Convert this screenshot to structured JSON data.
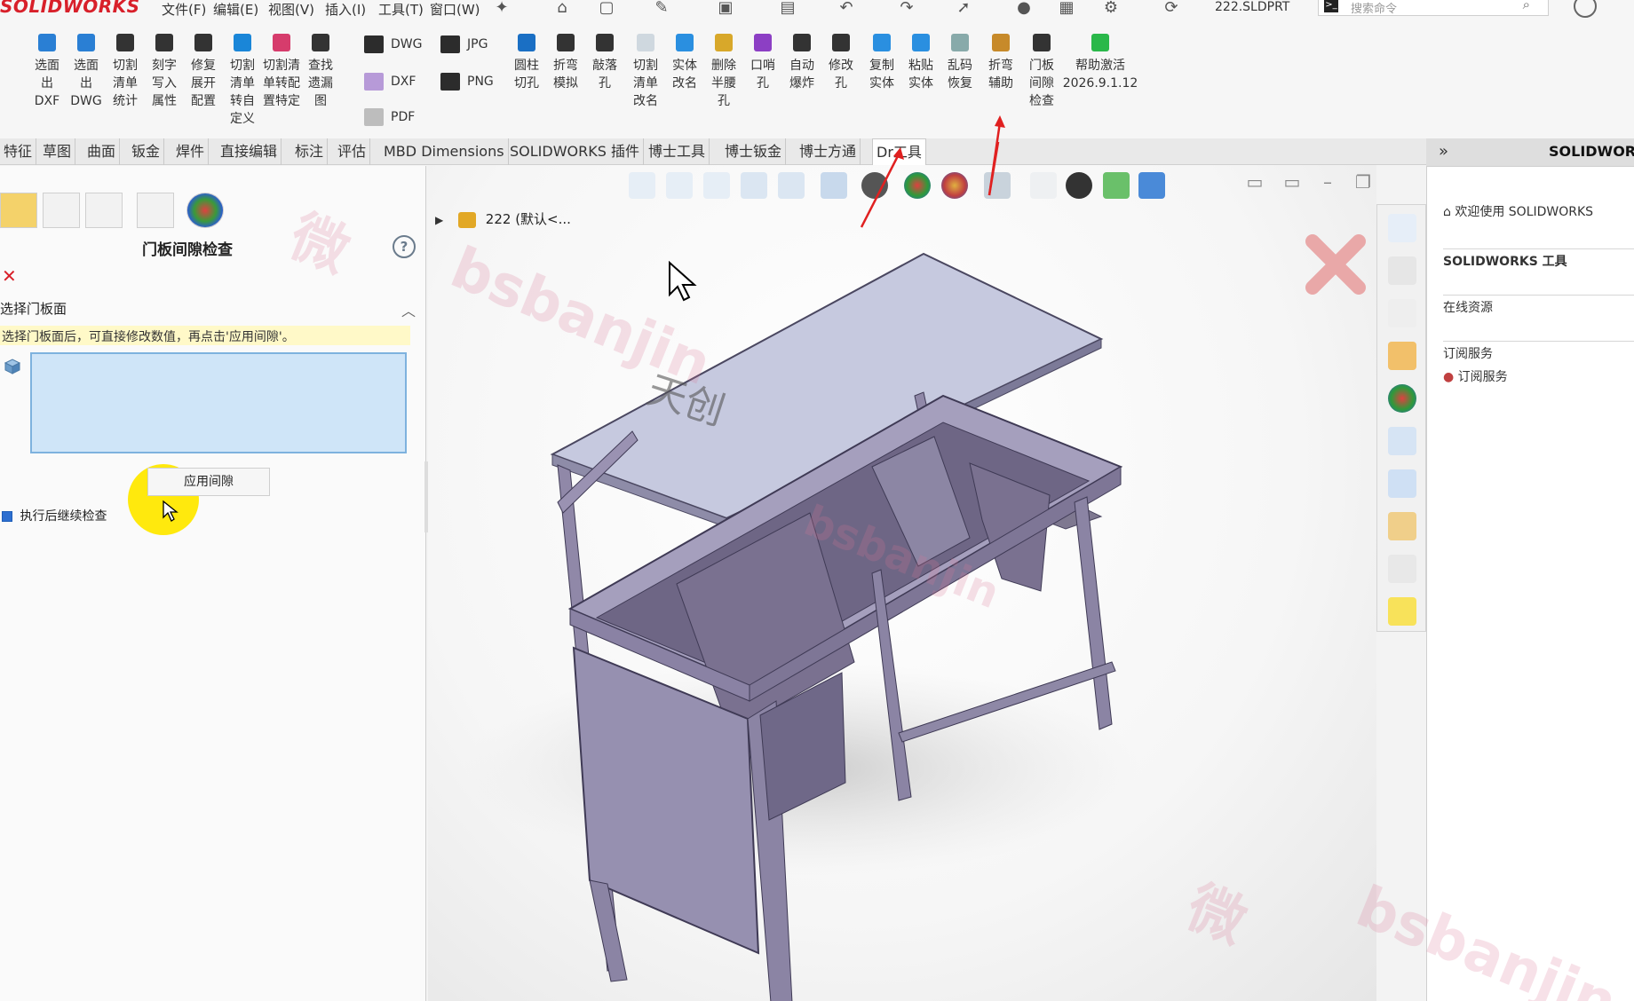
{
  "app": {
    "logo": "SOLIDWORKS",
    "filename": "222.SLDPRT",
    "search_placeholder": "搜索命令"
  },
  "menu": [
    "文件(F)",
    "编辑(E)",
    "视图(V)",
    "插入(I)",
    "工具(T)",
    "窗口(W)"
  ],
  "ribbon": {
    "buttons": [
      {
        "label": "选面\n出\nDXF",
        "icon": "export-dxf-icon",
        "color": "#2a7fd4"
      },
      {
        "label": "选面\n出\nDWG",
        "icon": "export-dwg-icon",
        "color": "#2a7fd4"
      },
      {
        "label": "切割\n清单\n统计",
        "icon": "cutlist-stats-icon",
        "color": "#333333"
      },
      {
        "label": "刻字\n写入\n属性",
        "icon": "engrave-icon",
        "color": "#333333"
      },
      {
        "label": "修复\n展开\n配置",
        "icon": "repair-icon",
        "color": "#333333"
      },
      {
        "label": "切割\n清单\n转自\n定义",
        "icon": "cutlist-custom-icon",
        "color": "#1a86d8"
      },
      {
        "label": "切割清\n单转配\n置特定",
        "icon": "cutlist-config-icon",
        "color": "#d63c6c"
      },
      {
        "label": "查找\n遗漏\n图",
        "icon": "find-icon",
        "color": "#333333"
      }
    ],
    "export_buttons": [
      {
        "label": "DWG",
        "icon": "dwg-icon"
      },
      {
        "label": "JPG",
        "icon": "jpg-icon"
      },
      {
        "label": "DXF",
        "icon": "dxf-icon"
      },
      {
        "label": "PNG",
        "icon": "png-icon"
      },
      {
        "label": "PDF",
        "icon": "pdf-icon"
      }
    ],
    "buttons2": [
      {
        "label": "圆柱\n切孔",
        "icon": "cylinder-cut-icon",
        "color": "#1a6fc4"
      },
      {
        "label": "折弯\n模拟",
        "icon": "bend-sim-icon",
        "color": "#333333"
      },
      {
        "label": "敲落\n孔",
        "icon": "knockout-icon",
        "color": "#333333"
      },
      {
        "label": "切割\n清单\n改名",
        "icon": "cutlist-rename-icon",
        "color": "#cfd8df"
      },
      {
        "label": "实体\n改名",
        "icon": "body-rename-icon",
        "color": "#2a8fe0"
      },
      {
        "label": "删除\n半腰\n孔",
        "icon": "delete-hole-icon",
        "color": "#d8a82a"
      },
      {
        "label": "口哨\n孔",
        "icon": "whistle-hole-icon",
        "color": "#8c3fc4"
      },
      {
        "label": "自动\n爆炸",
        "icon": "auto-explode-icon",
        "color": "#333333"
      },
      {
        "label": "修改\n孔",
        "icon": "modify-hole-icon",
        "color": "#333333"
      },
      {
        "label": "复制\n实体",
        "icon": "copy-body-icon",
        "color": "#2a8fe0"
      },
      {
        "label": "粘贴\n实体",
        "icon": "paste-body-icon",
        "color": "#2a8fe0"
      },
      {
        "label": "乱码\n恢复",
        "icon": "garble-restore-icon",
        "color": "#8aa"
      },
      {
        "label": "折弯\n辅助",
        "icon": "bend-assist-icon",
        "color": "#c78a2a"
      },
      {
        "label": "门板\n间隙\n检查",
        "icon": "door-gap-check-icon",
        "color": "#333333"
      },
      {
        "label": "帮助激活\n2026.9.1.12",
        "icon": "help-activate-icon",
        "color": "#2ab84a"
      }
    ]
  },
  "tabs": [
    "特征",
    "草图",
    "曲面",
    "钣金",
    "焊件",
    "直接编辑",
    "标注",
    "评估",
    "MBD Dimensions",
    "SOLIDWORKS 插件",
    "博士工具",
    "博士钣金",
    "博士方通",
    "Dr工具"
  ],
  "active_tab": "Dr工具",
  "property_manager": {
    "title": "门板间隙检查",
    "help": "?",
    "cancel": "✕",
    "section_title": "选择门板面",
    "hint": "选择门板面后，可直接修改数值，再点击'应用间隙'。",
    "apply_button": "应用间隙",
    "continue_check": "执行后继续检查"
  },
  "tree": {
    "root_label": "222 (默认<..."
  },
  "model_label": "天创",
  "task_pane": {
    "header": "SOLIDWORKS",
    "welcome": "欢迎使用 SOLIDWORKS",
    "tools": "SOLIDWORKS 工具",
    "online": "在线资源",
    "subscription": "订阅服务",
    "subscription_link": "订阅服务"
  },
  "watermarks": [
    "bsbanjin",
    "bsbanjin",
    "bsbanjin",
    "微",
    "微"
  ]
}
